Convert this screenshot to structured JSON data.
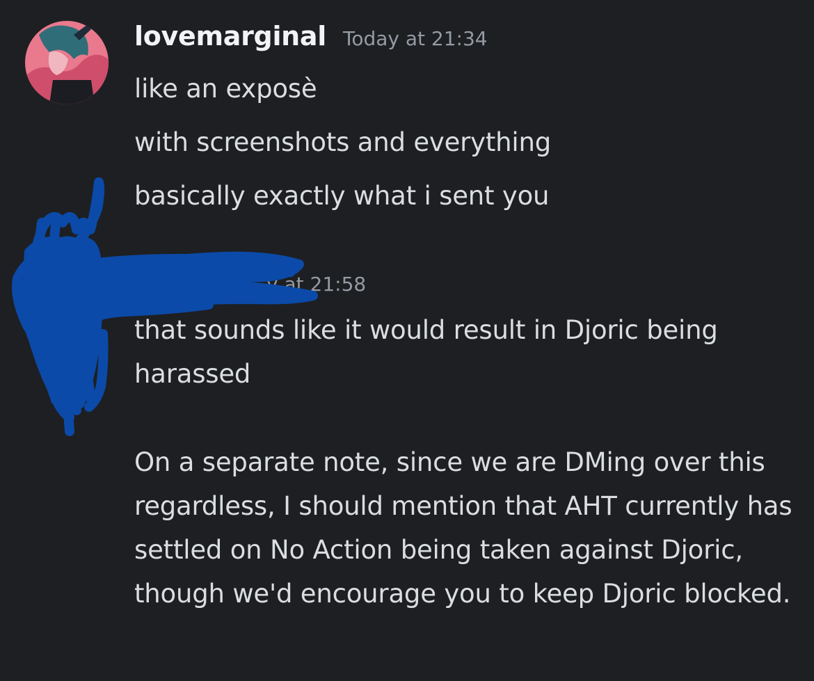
{
  "messages": [
    {
      "username": "lovemarginal",
      "timestamp": "Today at 21:34",
      "lines": [
        "like an exposè",
        "with screenshots and everything",
        "basically exactly what i sent you"
      ]
    },
    {
      "username": "",
      "timestamp_visible": "y at 21:58",
      "paragraphs": [
        "that sounds like it would result in Djoric being harassed",
        "On a separate note, since we are DMing over this regardless, I should mention that AHT currently has settled on No Action being taken against Djoric, though we'd encourage you to keep Djoric blocked."
      ]
    }
  ],
  "colors": {
    "background": "#1e1f22",
    "text": "#dbdee1",
    "username": "#f2f3f5",
    "muted": "#949ba4",
    "scribble": "#0b4aa8"
  },
  "icons": {
    "avatar": "user-avatar-illustration"
  }
}
